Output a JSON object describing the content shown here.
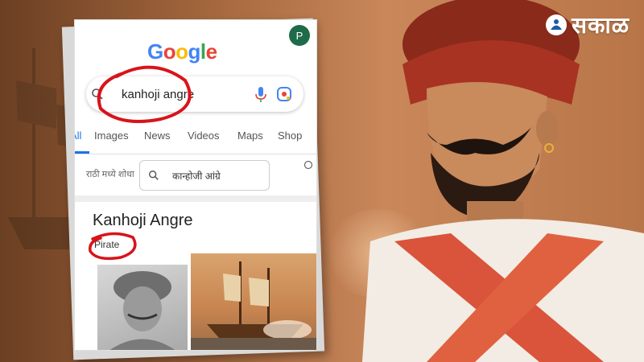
{
  "brand": {
    "name": "सकाळ",
    "icon": "lotus-icon"
  },
  "google": {
    "logo": "Google",
    "logo_colors": [
      "#4285F4",
      "#EA4335",
      "#FBBC05",
      "#4285F4",
      "#34A853",
      "#EA4335"
    ],
    "avatar_letter": "P",
    "search_query": "kanhoji angre",
    "tabs": [
      {
        "label": "All",
        "active": true
      },
      {
        "label": "Images"
      },
      {
        "label": "News"
      },
      {
        "label": "Videos"
      },
      {
        "label": "Maps"
      },
      {
        "label": "Shop"
      }
    ],
    "language_prompt": "राठी मध्ये शोधा",
    "language_chip": "कान्होजी आंग्रे",
    "knowledge_panel": {
      "title": "Kanhoji Angre",
      "subtitle": "Pirate"
    }
  },
  "annotation_color": "#d8141a"
}
